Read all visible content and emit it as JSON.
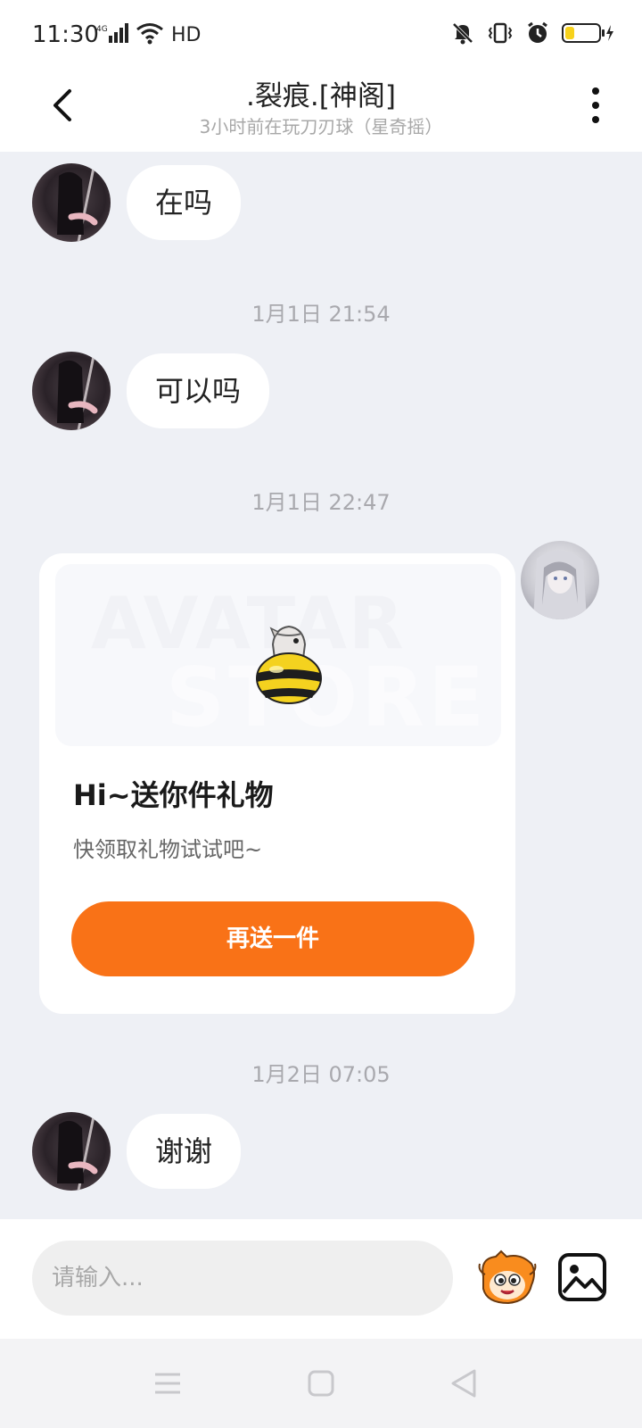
{
  "status_bar": {
    "time": "11:30",
    "network_label": "4G",
    "hd_label": "HD",
    "battery_color": "#f7d21c"
  },
  "header": {
    "title": ".裂痕.[神阁]",
    "subtitle": "3小时前在玩刀刃球（星奇摇）"
  },
  "messages": [
    {
      "type": "text",
      "from": "friend",
      "text": "在吗"
    },
    {
      "type": "timestamp",
      "text": "1月1日 21:54"
    },
    {
      "type": "text",
      "from": "friend",
      "text": "可以吗"
    },
    {
      "type": "timestamp",
      "text": "1月1日 22:47"
    },
    {
      "type": "gift",
      "from": "me",
      "banner_watermark_top": "AVATAR",
      "banner_watermark_bottom": "STORE",
      "title": "Hi~送你件礼物",
      "description": "快领取礼物试试吧~",
      "button_label": "再送一件",
      "accent_color": "#f97217"
    },
    {
      "type": "timestamp",
      "text": "1月2日 07:05"
    },
    {
      "type": "text",
      "from": "friend",
      "text": "谢谢"
    }
  ],
  "input": {
    "placeholder": "请输入...",
    "value": ""
  },
  "icons": {
    "back": "back-arrow-icon",
    "more": "more-vertical-icon",
    "emoji": "emoji-mascot-icon",
    "image": "image-icon",
    "nav_menu": "menu-icon",
    "nav_home": "home-icon",
    "nav_back": "triangle-back-icon"
  }
}
